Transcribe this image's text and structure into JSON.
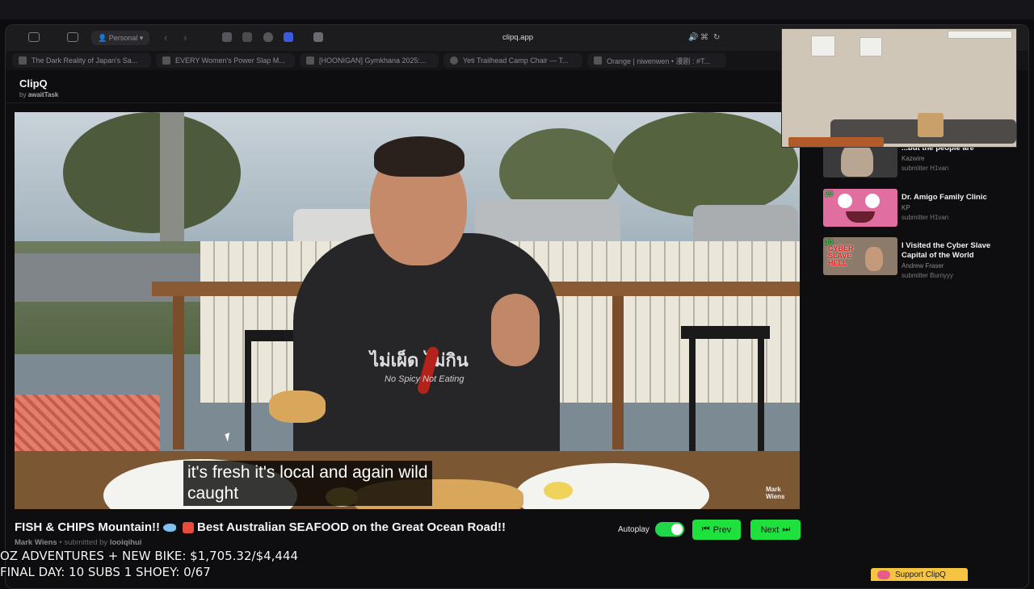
{
  "browser": {
    "url": "clipq.app",
    "profile_label": "Personal",
    "tabs": [
      {
        "label": "The Dark Reality of Japan's Sa..."
      },
      {
        "label": "EVERY Women's Power Slap M..."
      },
      {
        "label": "[HOONIGAN] Gymkhana 2025:..."
      },
      {
        "label": "Yeti Trailhead Camp Chair — T..."
      },
      {
        "label": "Orange | niwenwen • 漫剧 : #T..."
      }
    ]
  },
  "app": {
    "name": "ClipQ",
    "by_prefix": "by",
    "by_author": "awaitTask"
  },
  "video": {
    "caption_line1": "it's fresh it's local and again wild",
    "caption_line2": "caught",
    "watermark_line1": "Mark",
    "watermark_line2": "Wiens",
    "hoodie_text": "ไม่เผ็ด ไม่กิน",
    "hoodie_subtext": "No Spicy  Not Eating",
    "title_part1": "FISH & CHIPS Mountain!!",
    "title_part2": "Best Australian SEAFOOD on the Great Ocean Road!!",
    "channel": "Mark Wiens",
    "submitted_prefix": "• submitted by",
    "submitted_by": "looiqihui"
  },
  "controls": {
    "autoplay_label": "Autoplay",
    "autoplay_on": true,
    "prev_label": "Prev",
    "next_label": "Next"
  },
  "sidebar": {
    "items": [
      {
        "rank": "",
        "title": "...but the people are",
        "channel": "Kazwire",
        "submitter": "submitter H1van"
      },
      {
        "rank": "29",
        "title": "Dr. Amigo Family Clinic",
        "channel": "KP",
        "submitter": "submitter H1van"
      },
      {
        "rank": "30",
        "title": "I Visited the Cyber Slave Capital of the World",
        "channel": "Andrew Fraser",
        "submitter": "submitter Burnyyy"
      }
    ],
    "thumb3_text": "CYBER SLAVE HELL"
  },
  "overlay": {
    "line1": "OZ ADVENTURES + NEW BIKE: $1,705.32/$4,444",
    "line2": "FINAL DAY: 10 SUBS 1 SHOEY: 0/67"
  },
  "support_label": "Support ClipQ",
  "colors": {
    "accent_green": "#1fe13d",
    "background": "#0c0c0e",
    "support_yellow": "#f5c542"
  }
}
